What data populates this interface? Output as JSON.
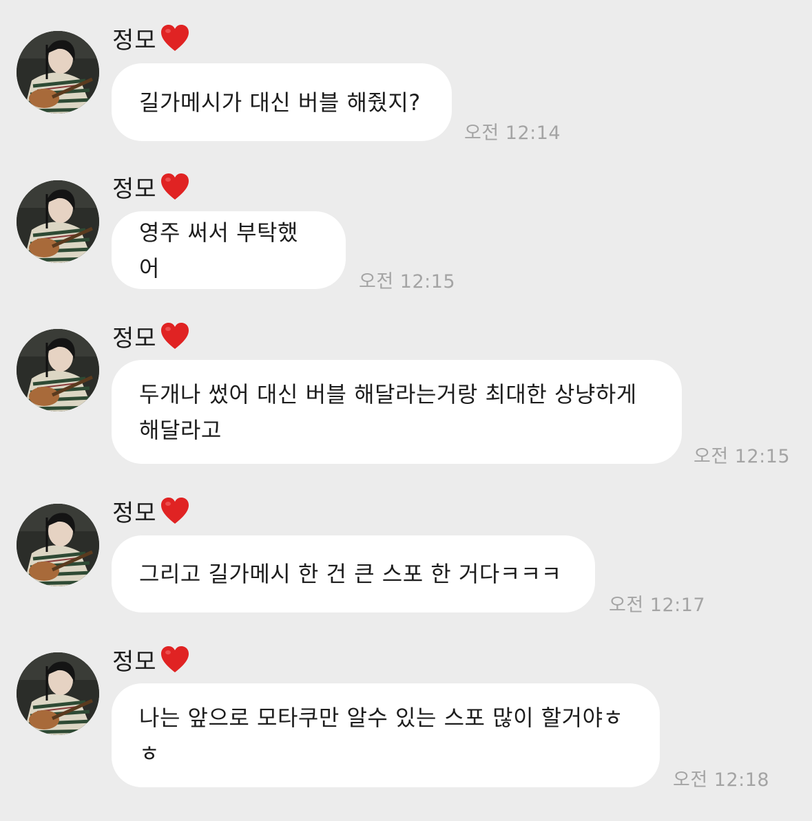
{
  "messages": [
    {
      "sender": "정모",
      "sender_icon": "heart-icon",
      "text": "길가메시가 대신 버블 해줬지?",
      "time": "오전 12:14"
    },
    {
      "sender": "정모",
      "sender_icon": "heart-icon",
      "text": "영주 써서 부탁했어",
      "time": "오전 12:15"
    },
    {
      "sender": "정모",
      "sender_icon": "heart-icon",
      "text": "두개나 썼어 대신 버블 해달라는거랑 최대한 상냥하게\n해달라고",
      "time": "오전 12:15"
    },
    {
      "sender": "정모",
      "sender_icon": "heart-icon",
      "text": "그리고 길가메시 한 건 큰 스포 한 거다ㅋㅋㅋ",
      "time": "오전 12:17"
    },
    {
      "sender": "정모",
      "sender_icon": "heart-icon",
      "text": "나는 앞으로 모타쿠만 알수 있는 스포 많이 할거야ㅎ\nㅎ",
      "time": "오전 12:18"
    }
  ],
  "colors": {
    "background": "#ececec",
    "bubble": "#ffffff",
    "timestamp": "#a4a4a4",
    "heart": "#e02323"
  }
}
